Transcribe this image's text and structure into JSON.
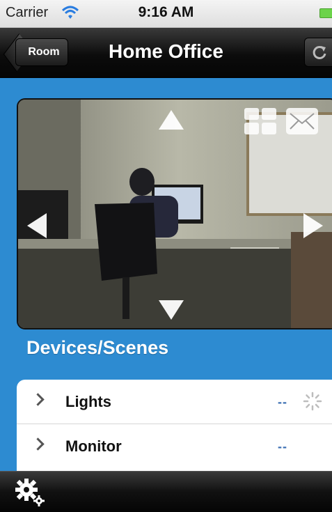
{
  "status_bar": {
    "carrier": "Carrier",
    "time": "9:16 AM"
  },
  "nav": {
    "back_label": "Room",
    "title": "Home Office"
  },
  "camera": {
    "controls": [
      "pan-up",
      "pan-down",
      "pan-left",
      "pan-right",
      "grid-view",
      "email"
    ]
  },
  "section": {
    "title": "Devices/Scenes"
  },
  "devices": [
    {
      "name": "Lights",
      "status": "--",
      "loading": true
    },
    {
      "name": "Monitor",
      "status": "--",
      "loading": false
    }
  ],
  "colors": {
    "background": "#2d8bd1",
    "status_text": "#3b6fb3"
  }
}
